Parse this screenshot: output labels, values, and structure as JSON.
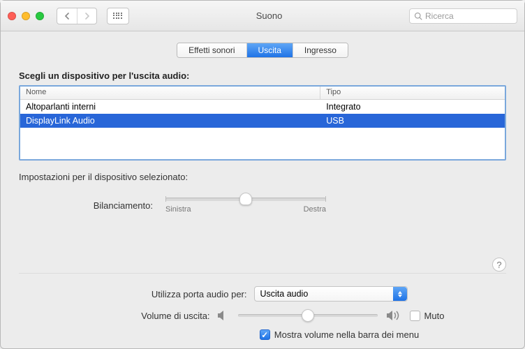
{
  "window": {
    "title": "Suono"
  },
  "search": {
    "placeholder": "Ricerca"
  },
  "tabs": {
    "effects": "Effetti sonori",
    "output": "Uscita",
    "input": "Ingresso"
  },
  "section": {
    "choose_device": "Scegli un dispositivo per l'uscita audio:"
  },
  "table": {
    "headers": {
      "name": "Nome",
      "type": "Tipo"
    },
    "rows": [
      {
        "name": "Altoparlanti interni",
        "type": "Integrato"
      },
      {
        "name": "DisplayLink Audio",
        "type": "USB"
      }
    ]
  },
  "settings_label": "Impostazioni per il dispositivo selezionato:",
  "balance": {
    "label": "Bilanciamento:",
    "left": "Sinistra",
    "right": "Destra"
  },
  "port": {
    "label": "Utilizza porta audio per:",
    "value": "Uscita audio"
  },
  "volume": {
    "label": "Volume di uscita:",
    "mute_label": "Muto",
    "percent": 50
  },
  "menubar_checkbox": "Mostra volume nella barra dei menu",
  "help_char": "?"
}
